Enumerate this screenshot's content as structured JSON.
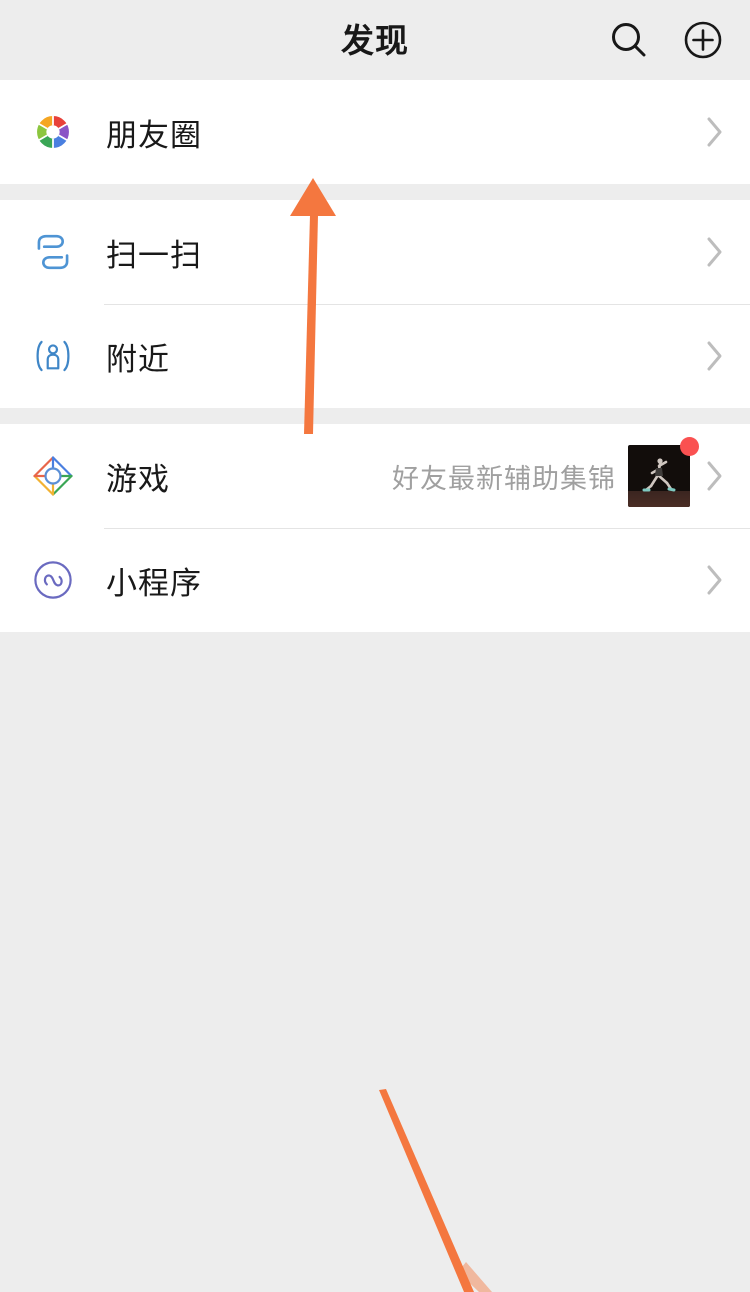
{
  "header": {
    "title": "发现",
    "search_icon": "search-icon",
    "add_icon": "plus-circle-icon"
  },
  "list": {
    "groups": [
      {
        "rows": [
          {
            "label": "朋友圈",
            "icon": "moments-aperture-icon",
            "subtitle": "",
            "chevron": "chevron-right-icon",
            "badge": false
          }
        ]
      },
      {
        "rows": [
          {
            "label": "扫一扫",
            "icon": "scan-icon",
            "subtitle": "",
            "chevron": "chevron-right-icon",
            "badge": false
          },
          {
            "label": "附近",
            "icon": "nearby-person-icon",
            "subtitle": "",
            "chevron": "chevron-right-icon",
            "badge": false
          }
        ]
      },
      {
        "rows": [
          {
            "label": "游戏",
            "icon": "games-diamond-icon",
            "subtitle": "好友最新辅助集锦",
            "thumbnail": "runner-thumbnail",
            "chevron": "chevron-right-icon",
            "badge": true
          },
          {
            "label": "小程序",
            "icon": "mini-program-icon",
            "subtitle": "",
            "chevron": "chevron-right-icon",
            "badge": false
          }
        ]
      }
    ]
  },
  "annotations": {
    "up_arrow": "orange-up-arrow",
    "diagonal_line": "orange-diagonal-line"
  },
  "colors": {
    "page_background": "#ededed",
    "row_background": "#ffffff",
    "title_text": "#181818",
    "label_text": "#191919",
    "subtitle_text": "#a0a0a0",
    "chevron": "#b9b9b9",
    "badge_red": "#fa5151",
    "annotation_orange": "#f4773f",
    "scan_blue": "#4e94d4",
    "nearby_blue": "#3f86c7",
    "mini_program_purple": "#6a6ac0"
  }
}
